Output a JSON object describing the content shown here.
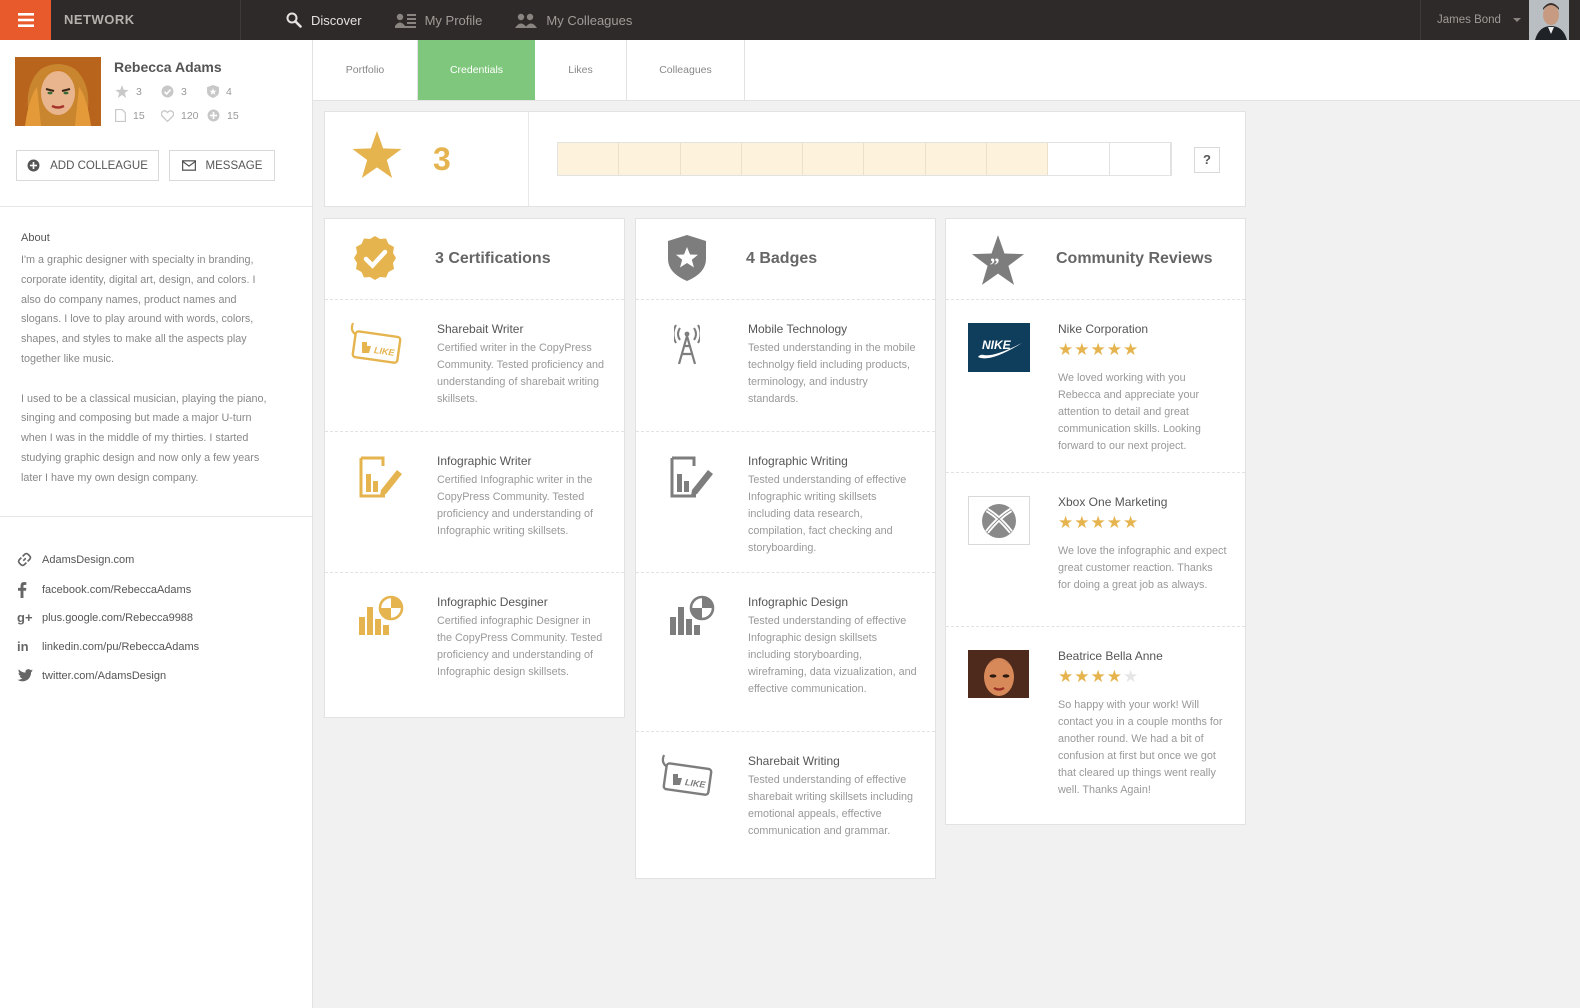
{
  "topbar": {
    "brand": "NETWORK",
    "nav": [
      {
        "label": "Discover",
        "icon": "search-icon"
      },
      {
        "label": "My Profile",
        "icon": "profile-card-icon"
      },
      {
        "label": "My Colleagues",
        "icon": "colleagues-icon"
      }
    ],
    "user_name": "James Bond"
  },
  "profile": {
    "name": "Rebecca Adams",
    "stats": {
      "stars": "3",
      "certifications": "3",
      "badges": "4",
      "documents": "15",
      "likes": "120",
      "colleagues": "15"
    },
    "add_colleague_label": "ADD COLLEAGUE",
    "message_label": "MESSAGE",
    "about_title": "About",
    "about_p1": "I'm a graphic designer with specialty in branding, corporate identity, digital art, design, and colors. I also do company names, product names and slogans. I love to play around with words, colors, shapes, and styles to make all the aspects play together like music.",
    "about_p2": "I used to be a classical musician, playing the piano, singing and composing but made a major U-turn when I was in the middle of my thirties. I started studying graphic design and now only a few years later I have my own design company.",
    "links": [
      {
        "icon": "link-icon",
        "text": "AdamsDesign.com"
      },
      {
        "icon": "facebook-icon",
        "text": "facebook.com/RebeccaAdams"
      },
      {
        "icon": "google-plus-icon",
        "text": "plus.google.com/Rebecca9988"
      },
      {
        "icon": "linkedin-icon",
        "text": "linkedin.com/pu/RebeccaAdams"
      },
      {
        "icon": "twitter-icon",
        "text": "twitter.com/AdamsDesign"
      }
    ]
  },
  "tabs": [
    "Portfolio",
    "Credentials",
    "Likes",
    "Colleagues"
  ],
  "active_tab": "Credentials",
  "score": {
    "value": "3",
    "progress_segments_total": 10,
    "progress_segments_filled": 8,
    "help_label": "?"
  },
  "certifications": {
    "title": "3 Certifications",
    "items": [
      {
        "icon": "like-tag-icon",
        "title": "Sharebait Writer",
        "desc": "Certified writer in the CopyPress Community. Tested proficiency and understanding of  sharebait writing skillsets."
      },
      {
        "icon": "infographic-writer-icon",
        "title": "Infographic Writer",
        "desc": "Certified Infographic writer in the CopyPress Community. Tested proficiency and understanding of Infographic writing skillsets."
      },
      {
        "icon": "infographic-chart-icon",
        "title": "Infographic Desginer",
        "desc": "Certified infographic Designer in the CopyPress Community. Tested proficiency and understanding of Infographic design skillsets."
      }
    ]
  },
  "badges": {
    "title": "4 Badges",
    "items": [
      {
        "icon": "antenna-icon",
        "title": "Mobile Technology",
        "desc": "Tested understanding in the mobile technolgy field including products, terminology, and industry standards."
      },
      {
        "icon": "infographic-writer-icon",
        "title": "Infographic Writing",
        "desc": "Tested understanding of effective Infographic writing skillsets including data research, compilation, fact checking and storyboarding."
      },
      {
        "icon": "infographic-chart-icon",
        "title": "Infographic Design",
        "desc": "Tested understanding of effective Infographic design skillsets including storyboarding, wireframing, data vizualization, and effective communication."
      },
      {
        "icon": "like-tag-icon",
        "title": "Sharebait Writing",
        "desc": "Tested understanding of effective sharebait writing skillsets including emotional appeals, effective communication and grammar."
      }
    ]
  },
  "reviews": {
    "title": "Community Reviews",
    "items": [
      {
        "logo": "nike-logo",
        "name": "Nike Corporation",
        "rating": 5,
        "text": "We loved working with you Rebecca and appreciate your attention to detail and great communication skills. Looking forward to our next project."
      },
      {
        "logo": "xbox-logo",
        "name": "Xbox One Marketing",
        "rating": 5,
        "text": "We love the infographic and expect great customer reaction. Thanks for doing a great job as always."
      },
      {
        "logo": "portrait-avatar",
        "name": "Beatrice Bella Anne",
        "rating": 4,
        "text": "So happy with your work! Will contact you in a couple months for another round. We had a bit of confusion at first but once we got that cleared up things went really well. Thanks Again!"
      }
    ]
  },
  "colors": {
    "accent_orange": "#e8592b",
    "active_tab_green": "#7fc77c",
    "gold": "#e5b44e",
    "icon_gray": "#7d7d7d",
    "topbar": "#2d2a29"
  }
}
